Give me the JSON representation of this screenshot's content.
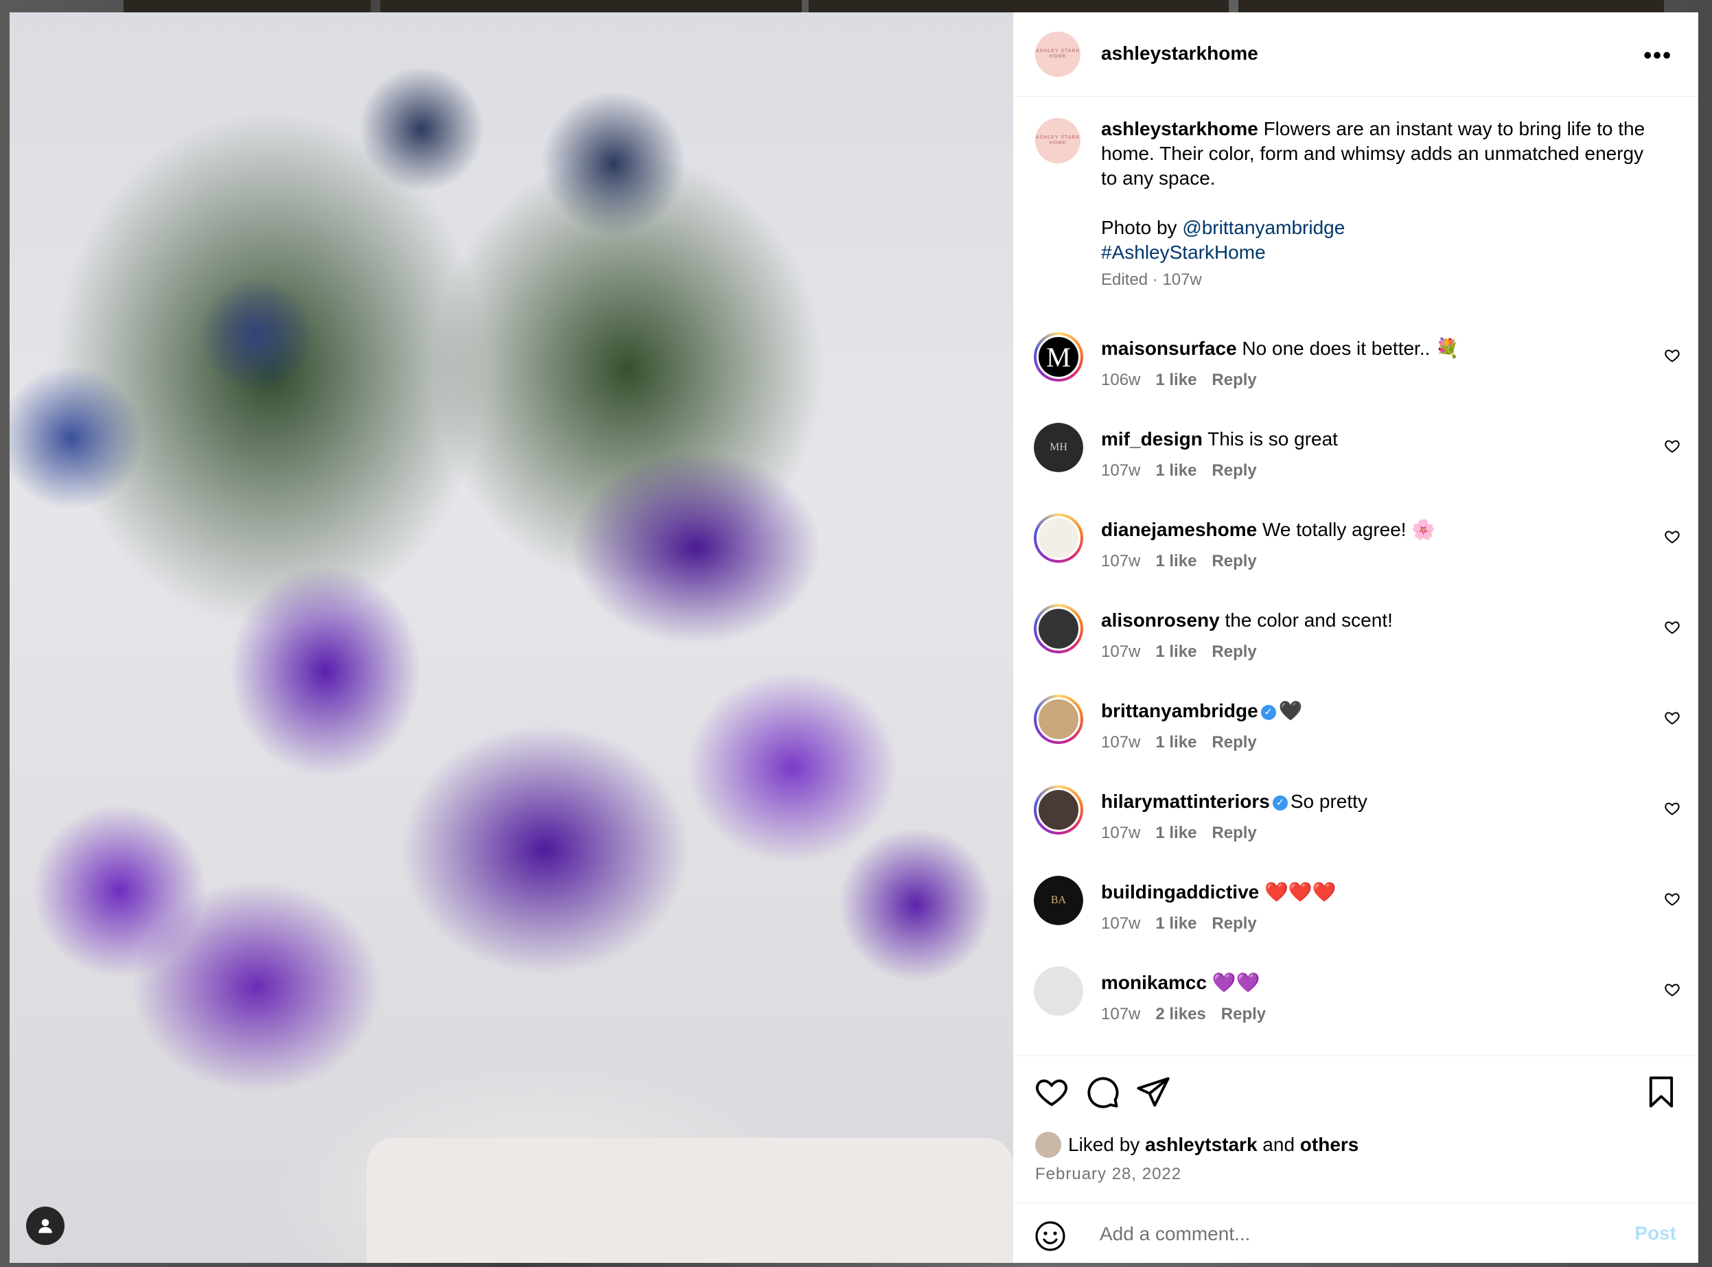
{
  "post": {
    "username": "ashleystarkhome",
    "avatar_text": "ASHLEY STARK HOME",
    "caption": {
      "username": "ashleystarkhome",
      "text": "Flowers are an instant way to bring life to the home. Their color, form and whimsy adds an unmatched energy to any space.",
      "photo_by_prefix": "Photo by",
      "photo_by_handle": "@brittanyambridge",
      "hashtag": "#AshleyStarkHome",
      "edited": "Edited · 107w"
    }
  },
  "comments": [
    {
      "username": "maisonsurface",
      "text": "No one does it better.. 💐",
      "age": "106w",
      "likes": "1 like",
      "reply": "Reply",
      "verified": false,
      "avatar_glyph": "M"
    },
    {
      "username": "mif_design",
      "text": "This is so great",
      "age": "107w",
      "likes": "1 like",
      "reply": "Reply",
      "verified": false,
      "avatar_glyph": "MH"
    },
    {
      "username": "dianejameshome",
      "text": "We totally agree! 🌸",
      "age": "107w",
      "likes": "1 like",
      "reply": "Reply",
      "verified": false,
      "avatar_glyph": ""
    },
    {
      "username": "alisonroseny",
      "text": "the color and scent!",
      "age": "107w",
      "likes": "1 like",
      "reply": "Reply",
      "verified": false,
      "avatar_glyph": ""
    },
    {
      "username": "brittanyambridge",
      "text": "🖤",
      "age": "107w",
      "likes": "1 like",
      "reply": "Reply",
      "verified": true,
      "avatar_glyph": ""
    },
    {
      "username": "hilarymattinteriors",
      "text": "So pretty",
      "age": "107w",
      "likes": "1 like",
      "reply": "Reply",
      "verified": true,
      "avatar_glyph": ""
    },
    {
      "username": "buildingaddictive",
      "text": "❤️❤️❤️",
      "age": "107w",
      "likes": "1 like",
      "reply": "Reply",
      "verified": false,
      "avatar_glyph": "BA"
    },
    {
      "username": "monikamcc",
      "text": "💜💜",
      "age": "107w",
      "likes": "2 likes",
      "reply": "Reply",
      "verified": false,
      "avatar_glyph": ""
    }
  ],
  "actions": {
    "liked_prefix": "Liked by",
    "liked_user": "ashleytstark",
    "liked_and": "and",
    "liked_others": "others",
    "date": "February 28, 2022"
  },
  "composer": {
    "placeholder": "Add a comment...",
    "post_label": "Post"
  },
  "icons": {
    "more": "more-options-icon",
    "like": "heart-icon",
    "comment": "comment-icon",
    "share": "share-icon",
    "save": "bookmark-icon",
    "emoji": "emoji-icon",
    "user": "user-icon"
  },
  "colors": {
    "link": "#00376b",
    "muted": "#737373",
    "post_disabled": "#b2dffc",
    "verified": "#3897f0"
  }
}
